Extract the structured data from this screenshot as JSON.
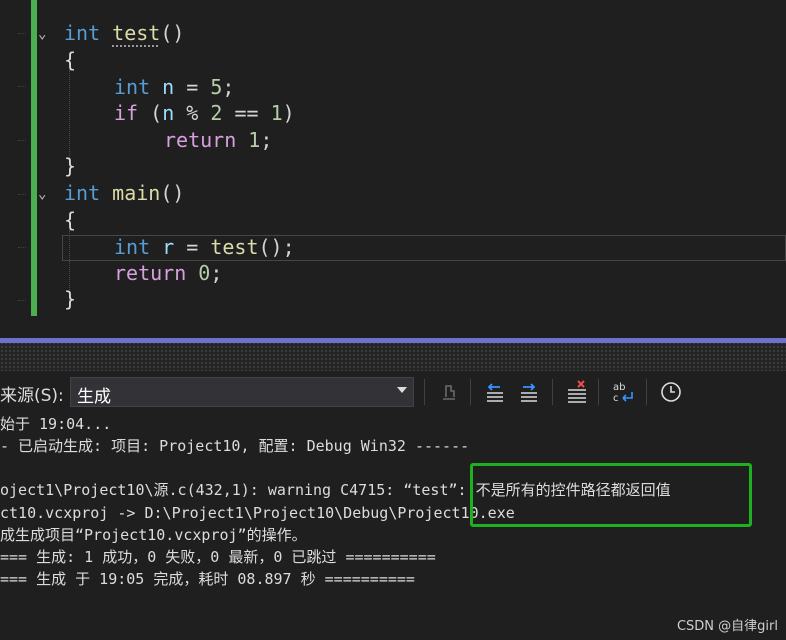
{
  "editor": {
    "lines": [
      {
        "kw": "int",
        "fn": "test",
        "rest": "()"
      },
      {
        "text": "{"
      },
      {
        "kw": "int",
        "var": "n",
        "eq": " = ",
        "num": "5",
        "end": ";"
      },
      {
        "kw": "if",
        "rest1": " (",
        "var": "n",
        "op": " % ",
        "num1": "2",
        "op2": " == ",
        "num2": "1",
        "rest2": ")"
      },
      {
        "kw": "return",
        "num": "1",
        "end": ";"
      },
      {
        "text": "}"
      },
      {
        "kw": "int",
        "fn": "main",
        "rest": "()"
      },
      {
        "text": "{"
      },
      {
        "kw": "int",
        "var": "r",
        "eq": " = ",
        "fn": "test",
        "rest": "();"
      },
      {
        "kw": "return",
        "num": "0",
        "end": ";"
      },
      {
        "text": "}"
      }
    ]
  },
  "output": {
    "source_label": "来源(S):",
    "source_value": "生成",
    "lines": [
      "始于 19:04...",
      "- 已启动生成: 项目: Project10, 配置: Debug Win32 ------",
      "",
      "oject1\\Project10\\源.c(432,1): warning C4715: “test”: 不是所有的控件路径都返回值",
      "ct10.vcxproj -> D:\\Project1\\Project10\\Debug\\Project10.exe",
      "成生成项目“Project10.vcxproj”的操作。",
      "=== 生成: 1 成功，0 失败，0 最新，0 已跳过 ==========",
      "=== 生成 于 19:05 完成，耗时 08.897 秒 =========="
    ]
  },
  "watermark": "CSDN @自律girl",
  "colors": {
    "accent_green": "#1eb01e",
    "splitter": "#6f6fd0",
    "change_bar": "#4caf50"
  },
  "icons": [
    "go-to-build-icon",
    "previous-message-icon",
    "next-message-icon",
    "clear-all-icon",
    "word-wrap-icon",
    "timestamp-clock-icon"
  ]
}
